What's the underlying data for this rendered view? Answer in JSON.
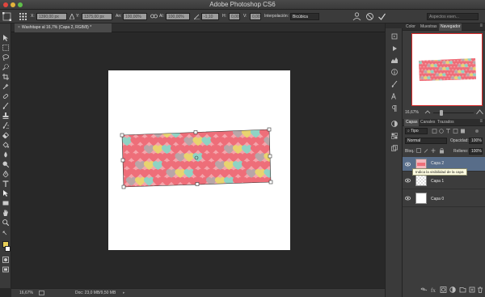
{
  "app": {
    "title": "Adobe Photoshop CS6",
    "window_controls": {
      "close": "#e0463e",
      "minimize": "#e2b33c",
      "maximize": "#5fbf4a"
    }
  },
  "options_bar": {
    "x_label": "X:",
    "x_value": "1390,00 px",
    "y_label": "Y:",
    "y_value": "1375,00 px",
    "w_label": "An:",
    "w_value": "100,00%",
    "h_label": "Al:",
    "h_value": "100,00%",
    "angle_value": "-1,10",
    "hskew_label": "H:",
    "hskew_value": "0,00",
    "vskew_label": "V:",
    "vskew_value": "0,00",
    "interp_label": "Interpolación:",
    "interp_value": "Bicúbica",
    "workspace_label": "Aspectos esen..."
  },
  "document": {
    "tab_label": "Washitape al 16,7% (Capa 2, RGB/8) *",
    "tape_colors": {
      "base": "#ee6e79",
      "mint": "#8fd3c4",
      "yellow": "#e9d36f",
      "grey": "#b8a6a8"
    }
  },
  "status_bar": {
    "zoom": "16,67%",
    "doc_info": "Doc: 23,0 MB/9,50 MB"
  },
  "panels": {
    "top_tabs": [
      "Color",
      "Muestras",
      "Navegador"
    ],
    "active_top_tab": "Navegador",
    "nav_zoom": "16,67%",
    "layers_tabs": [
      "Capas",
      "Canales",
      "Trazados"
    ],
    "filter_label": "Tipo",
    "blend_mode": "Normal",
    "opacity_label": "Opacidad:",
    "opacity_value": "100%",
    "lock_label": "Bloq.:",
    "fill_label": "Relleno:",
    "fill_value": "100%",
    "layers": [
      {
        "name": "Capa 2",
        "selected": true
      },
      {
        "name": "Capa 1",
        "selected": false
      },
      {
        "name": "Capa 0",
        "selected": false
      }
    ],
    "tooltip": "Indica la visibilidad de la capa"
  },
  "colors": {
    "foreground": "#e8cf57",
    "background": "#ffffff",
    "selection_blue": "#586d89"
  }
}
